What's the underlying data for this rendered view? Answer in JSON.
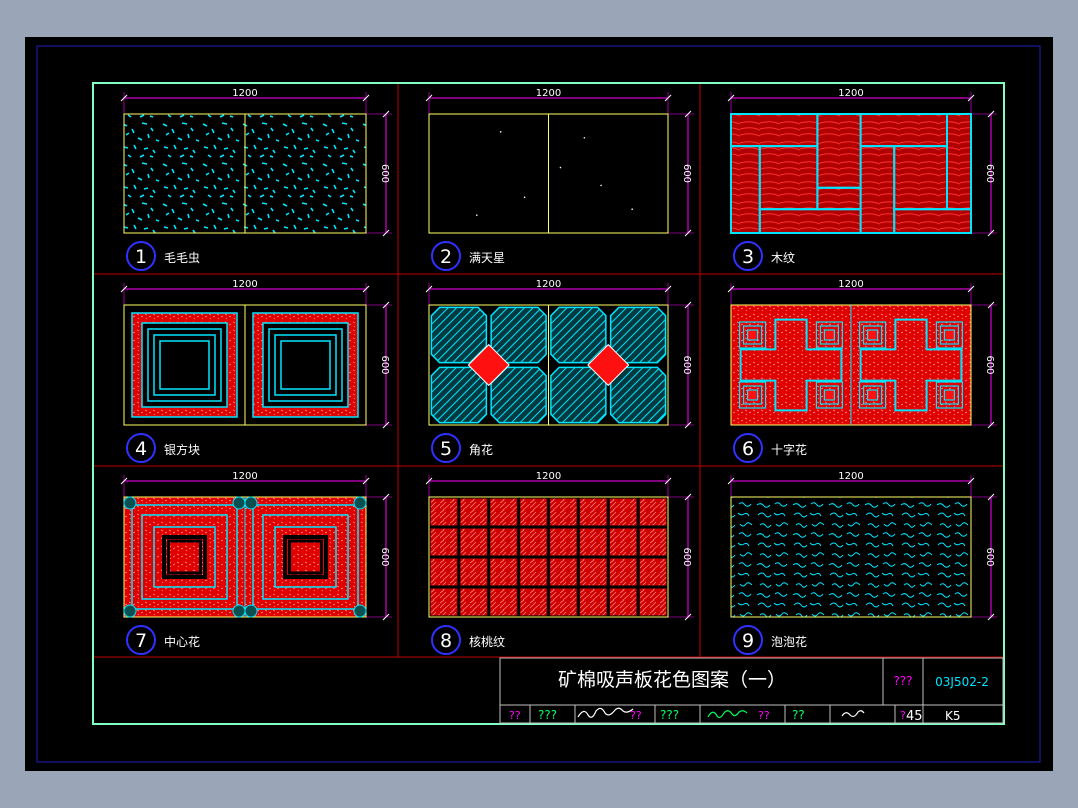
{
  "dimension_width": "1200",
  "dimension_height": "600",
  "panels": [
    {
      "num": "1",
      "name": "毛毛虫",
      "pattern": "speckle"
    },
    {
      "num": "2",
      "name": "满天星",
      "pattern": "stars"
    },
    {
      "num": "3",
      "name": "木纹",
      "pattern": "wood"
    },
    {
      "num": "4",
      "name": "银方块",
      "pattern": "squares"
    },
    {
      "num": "5",
      "name": "角花",
      "pattern": "corner"
    },
    {
      "num": "6",
      "name": "十字花",
      "pattern": "cross"
    },
    {
      "num": "7",
      "name": "中心花",
      "pattern": "center"
    },
    {
      "num": "8",
      "name": "核桃纹",
      "pattern": "walnut"
    },
    {
      "num": "9",
      "name": "泡泡花",
      "pattern": "bubble"
    }
  ],
  "title_block": {
    "title": "矿棉吸声板花色图案（一）",
    "label_atlas": "???",
    "atlas_no": "03J502-2",
    "q1": "??",
    "q2": "???",
    "q3": "??",
    "q4": "???",
    "q5": "??",
    "q6": "??",
    "q7": "?",
    "page_no": "45",
    "page_code": "K5"
  },
  "colors": {
    "background": "#000000",
    "frame": "#80ffc0",
    "grid": "#c00000",
    "dimension": "#ff00ff",
    "panel_border": "#ffff66",
    "cyan": "#00e5ff",
    "red": "#ff1010",
    "circle": "#3030ff",
    "text": "#ffffff"
  }
}
